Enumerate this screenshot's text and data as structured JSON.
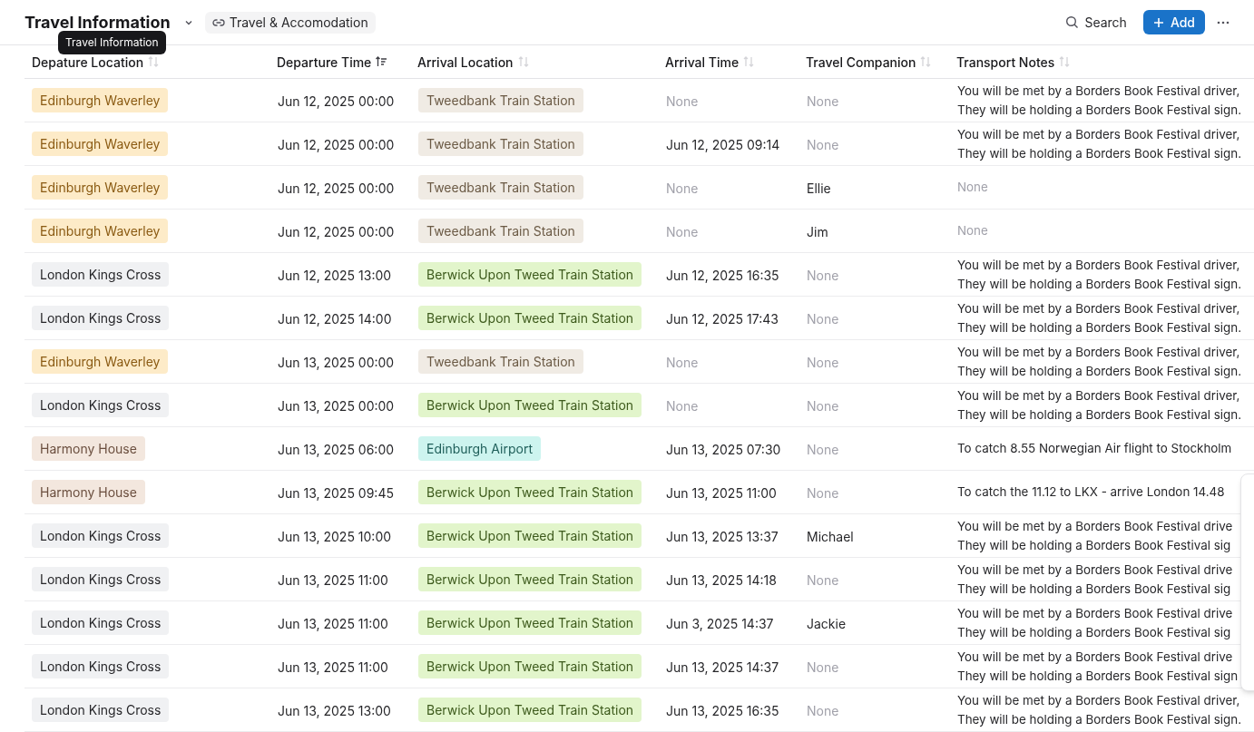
{
  "header": {
    "title": "Travel Information",
    "link": "Travel & Accomodation",
    "search": "Search",
    "add": "Add"
  },
  "tooltip": "Travel Information",
  "columns": [
    {
      "label": "Depature Location",
      "sorted": false
    },
    {
      "label": "Departure Time",
      "sorted": true
    },
    {
      "label": "Arrival Location",
      "sorted": false
    },
    {
      "label": "Arrival Time",
      "sorted": false
    },
    {
      "label": "Travel Companion",
      "sorted": false
    },
    {
      "label": "Transport Notes",
      "sorted": false
    }
  ],
  "rows": [
    {
      "departure": {
        "text": "Edinburgh Waverley",
        "color": "#fdebc8"
      },
      "departure_time": "Jun 12, 2025 00:00",
      "arrival": {
        "text": "Tweedbank Train Station",
        "color": "#f0ebe4"
      },
      "arrival_time": {
        "text": "None",
        "muted": true
      },
      "companion": {
        "text": "None",
        "muted": true
      },
      "notes": {
        "lines": [
          "You will be met by a Borders Book Festival driver,",
          "They will be holding a Borders Book Festival sign."
        ],
        "muted": false
      }
    },
    {
      "departure": {
        "text": "Edinburgh Waverley",
        "color": "#fdebc8"
      },
      "departure_time": "Jun 12, 2025 00:00",
      "arrival": {
        "text": "Tweedbank Train Station",
        "color": "#f0ebe4"
      },
      "arrival_time": {
        "text": "Jun 12, 2025 09:14",
        "muted": false
      },
      "companion": {
        "text": "None",
        "muted": true
      },
      "notes": {
        "lines": [
          "You will be met by a Borders Book Festival driver,",
          "They will be holding a Borders Book Festival sign."
        ],
        "muted": false
      }
    },
    {
      "departure": {
        "text": "Edinburgh Waverley",
        "color": "#fdebc8"
      },
      "departure_time": "Jun 12, 2025 00:00",
      "arrival": {
        "text": "Tweedbank Train Station",
        "color": "#f0ebe4"
      },
      "arrival_time": {
        "text": "None",
        "muted": true
      },
      "companion": {
        "text": "Ellie",
        "muted": false
      },
      "notes": {
        "lines": [
          "None"
        ],
        "muted": true
      }
    },
    {
      "departure": {
        "text": "Edinburgh Waverley",
        "color": "#fdebc8"
      },
      "departure_time": "Jun 12, 2025 00:00",
      "arrival": {
        "text": "Tweedbank Train Station",
        "color": "#f0ebe4"
      },
      "arrival_time": {
        "text": "None",
        "muted": true
      },
      "companion": {
        "text": "Jim",
        "muted": false
      },
      "notes": {
        "lines": [
          "None"
        ],
        "muted": true
      }
    },
    {
      "departure": {
        "text": "London Kings Cross",
        "color": "#f0f1f3"
      },
      "departure_time": "Jun 12, 2025 13:00",
      "arrival": {
        "text": "Berwick Upon Tweed Train Station",
        "color": "#e2f5cb"
      },
      "arrival_time": {
        "text": "Jun 12, 2025 16:35",
        "muted": false
      },
      "companion": {
        "text": "None",
        "muted": true
      },
      "notes": {
        "lines": [
          "You will be met by a Borders Book Festival driver,",
          "They will be holding a Borders Book Festival sign."
        ],
        "muted": false
      }
    },
    {
      "departure": {
        "text": "London Kings Cross",
        "color": "#f0f1f3"
      },
      "departure_time": "Jun 12, 2025 14:00",
      "arrival": {
        "text": "Berwick Upon Tweed Train Station",
        "color": "#e2f5cb"
      },
      "arrival_time": {
        "text": "Jun 12, 2025 17:43",
        "muted": false
      },
      "companion": {
        "text": "None",
        "muted": true
      },
      "notes": {
        "lines": [
          "You will be met by a Borders Book Festival driver,",
          "They will be holding a Borders Book Festival sign."
        ],
        "muted": false
      }
    },
    {
      "departure": {
        "text": "Edinburgh Waverley",
        "color": "#fdebc8"
      },
      "departure_time": "Jun 13, 2025 00:00",
      "arrival": {
        "text": "Tweedbank Train Station",
        "color": "#f0ebe4"
      },
      "arrival_time": {
        "text": "None",
        "muted": true
      },
      "companion": {
        "text": "None",
        "muted": true
      },
      "notes": {
        "lines": [
          "You will be met by a Borders Book Festival driver,",
          "They will be holding a Borders Book Festival sign."
        ],
        "muted": false
      }
    },
    {
      "departure": {
        "text": "London Kings Cross",
        "color": "#f0f1f3"
      },
      "departure_time": "Jun 13, 2025 00:00",
      "arrival": {
        "text": "Berwick Upon Tweed Train Station",
        "color": "#e2f5cb"
      },
      "arrival_time": {
        "text": "None",
        "muted": true
      },
      "companion": {
        "text": "None",
        "muted": true
      },
      "notes": {
        "lines": [
          "You will be met by a Borders Book Festival driver,",
          "They will be holding a Borders Book Festival sign."
        ],
        "muted": false
      }
    },
    {
      "departure": {
        "text": "Harmony House",
        "color": "#f3e7de"
      },
      "departure_time": "Jun 13, 2025 06:00",
      "arrival": {
        "text": "Edinburgh Airport",
        "color": "#cdf4ef"
      },
      "arrival_time": {
        "text": "Jun 13, 2025 07:30",
        "muted": false
      },
      "companion": {
        "text": "None",
        "muted": true
      },
      "notes": {
        "lines": [
          "To catch 8.55 Norwegian Air flight to Stockholm"
        ],
        "muted": false
      }
    },
    {
      "departure": {
        "text": "Harmony House",
        "color": "#f3e7de"
      },
      "departure_time": "Jun 13, 2025 09:45",
      "arrival": {
        "text": "Berwick Upon Tweed Train Station",
        "color": "#e2f5cb"
      },
      "arrival_time": {
        "text": "Jun 13, 2025 11:00",
        "muted": false
      },
      "companion": {
        "text": "None",
        "muted": true
      },
      "notes": {
        "lines": [
          "To catch the 11.12 to LKX - arrive London 14.48"
        ],
        "muted": false
      }
    },
    {
      "departure": {
        "text": "London Kings Cross",
        "color": "#f0f1f3"
      },
      "departure_time": "Jun 13, 2025 10:00",
      "arrival": {
        "text": "Berwick Upon Tweed Train Station",
        "color": "#e2f5cb"
      },
      "arrival_time": {
        "text": "Jun 13, 2025 13:37",
        "muted": false
      },
      "companion": {
        "text": "Michael",
        "muted": false
      },
      "notes": {
        "lines": [
          "You will be met by a Borders Book Festival drive",
          "They will be holding a Borders Book Festival sig"
        ],
        "muted": false
      }
    },
    {
      "departure": {
        "text": "London Kings Cross",
        "color": "#f0f1f3"
      },
      "departure_time": "Jun 13, 2025 11:00",
      "arrival": {
        "text": "Berwick Upon Tweed Train Station",
        "color": "#e2f5cb"
      },
      "arrival_time": {
        "text": "Jun 13, 2025 14:18",
        "muted": false
      },
      "companion": {
        "text": "None",
        "muted": true
      },
      "notes": {
        "lines": [
          "You will be met by a Borders Book Festival drive",
          "They will be holding a Borders Book Festival sig"
        ],
        "muted": false
      }
    },
    {
      "departure": {
        "text": "London Kings Cross",
        "color": "#f0f1f3"
      },
      "departure_time": "Jun 13, 2025 11:00",
      "arrival": {
        "text": "Berwick Upon Tweed Train Station",
        "color": "#e2f5cb"
      },
      "arrival_time": {
        "text": "Jun 3, 2025 14:37",
        "muted": false
      },
      "companion": {
        "text": "Jackie",
        "muted": false
      },
      "notes": {
        "lines": [
          "You will be met by a Borders Book Festival drive",
          "They will be holding a Borders Book Festival sig"
        ],
        "muted": false
      }
    },
    {
      "departure": {
        "text": "London Kings Cross",
        "color": "#f0f1f3"
      },
      "departure_time": "Jun 13, 2025 11:00",
      "arrival": {
        "text": "Berwick Upon Tweed Train Station",
        "color": "#e2f5cb"
      },
      "arrival_time": {
        "text": "Jun 13, 2025 14:37",
        "muted": false
      },
      "companion": {
        "text": "None",
        "muted": true
      },
      "notes": {
        "lines": [
          "You will be met by a Borders Book Festival drive",
          "They will be holding a Borders Book Festival sign"
        ],
        "muted": false
      }
    },
    {
      "departure": {
        "text": "London Kings Cross",
        "color": "#f0f1f3"
      },
      "departure_time": "Jun 13, 2025 13:00",
      "arrival": {
        "text": "Berwick Upon Tweed Train Station",
        "color": "#e2f5cb"
      },
      "arrival_time": {
        "text": "Jun 13, 2025 16:35",
        "muted": false
      },
      "companion": {
        "text": "None",
        "muted": true
      },
      "notes": {
        "lines": [
          "You will be met by a Borders Book Festival driver,",
          "They will be holding a Borders Book Festival sign."
        ],
        "muted": false
      }
    }
  ]
}
